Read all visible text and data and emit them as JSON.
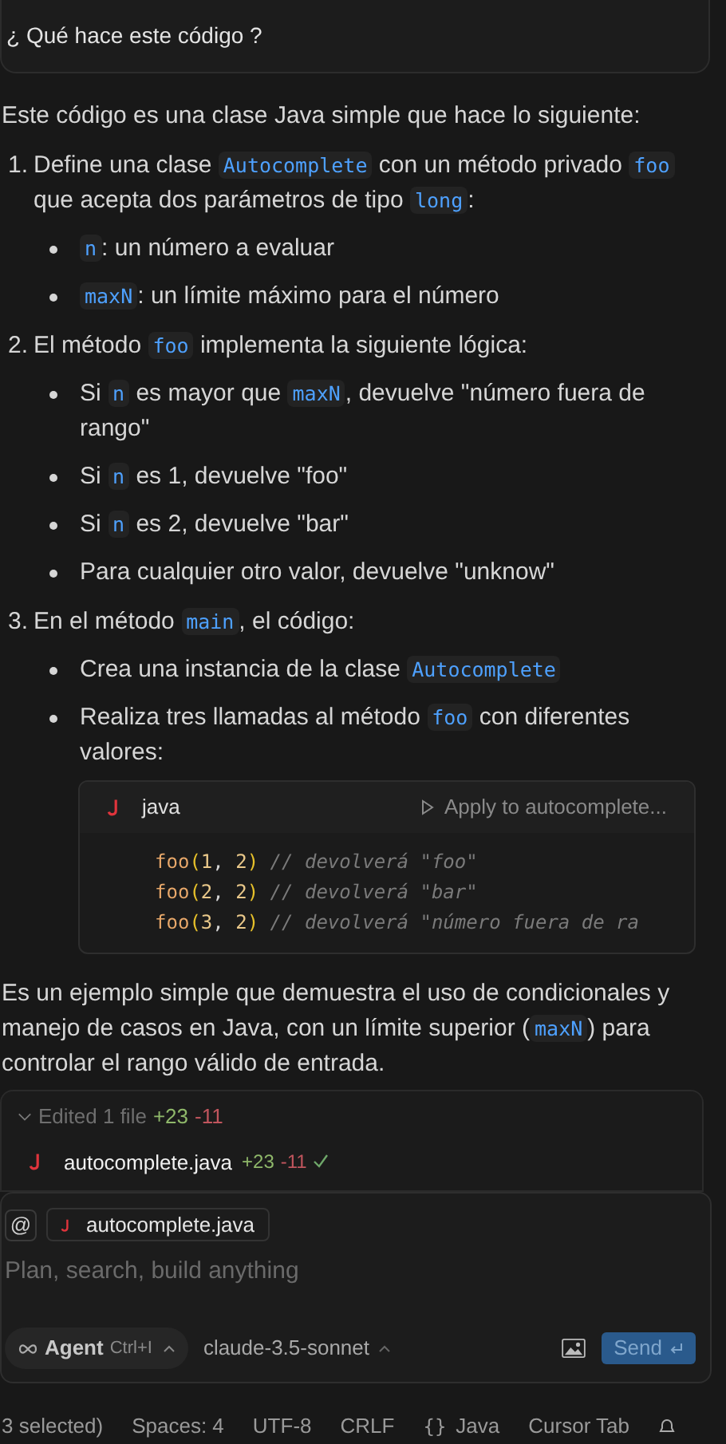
{
  "user_message": {
    "text": "¿ Qué hace este código ?"
  },
  "answer": {
    "intro": "Este código es una clase Java simple que hace lo siguiente:",
    "steps": [
      {
        "number": "1.",
        "parts": [
          {
            "kind": "text",
            "text": "Define una clase "
          },
          {
            "kind": "code",
            "text": "Autocomplete"
          },
          {
            "kind": "text",
            "text": " con un método privado "
          },
          {
            "kind": "code",
            "text": "foo"
          },
          {
            "kind": "text",
            "text": " que acepta dos parámetros de tipo "
          },
          {
            "kind": "code",
            "text": "long"
          },
          {
            "kind": "text",
            "text": ":"
          }
        ],
        "bullets": [
          {
            "parts": [
              {
                "kind": "code",
                "text": "n"
              },
              {
                "kind": "text",
                "text": ": un número a evaluar"
              }
            ]
          },
          {
            "parts": [
              {
                "kind": "code",
                "text": "maxN"
              },
              {
                "kind": "text",
                "text": ": un límite máximo para el número"
              }
            ]
          }
        ]
      },
      {
        "number": "2.",
        "parts": [
          {
            "kind": "text",
            "text": "El método "
          },
          {
            "kind": "code",
            "text": "foo"
          },
          {
            "kind": "text",
            "text": " implementa la siguiente lógica:"
          }
        ],
        "bullets": [
          {
            "parts": [
              {
                "kind": "text",
                "text": "Si "
              },
              {
                "kind": "code",
                "text": "n"
              },
              {
                "kind": "text",
                "text": " es mayor que "
              },
              {
                "kind": "code",
                "text": "maxN"
              },
              {
                "kind": "text",
                "text": ", devuelve \"número fuera de rango\""
              }
            ]
          },
          {
            "parts": [
              {
                "kind": "text",
                "text": "Si "
              },
              {
                "kind": "code",
                "text": "n"
              },
              {
                "kind": "text",
                "text": " es 1, devuelve \"foo\""
              }
            ]
          },
          {
            "parts": [
              {
                "kind": "text",
                "text": "Si "
              },
              {
                "kind": "code",
                "text": "n"
              },
              {
                "kind": "text",
                "text": " es 2, devuelve \"bar\""
              }
            ]
          },
          {
            "parts": [
              {
                "kind": "text",
                "text": "Para cualquier otro valor, devuelve \"unknow\""
              }
            ]
          }
        ]
      },
      {
        "number": "3.",
        "parts": [
          {
            "kind": "text",
            "text": "En el método "
          },
          {
            "kind": "code",
            "text": "main"
          },
          {
            "kind": "text",
            "text": ", el código:"
          }
        ],
        "bullets": [
          {
            "parts": [
              {
                "kind": "text",
                "text": "Crea una instancia de la clase "
              },
              {
                "kind": "code",
                "text": "Autocomplete"
              }
            ]
          },
          {
            "parts": [
              {
                "kind": "text",
                "text": "Realiza tres llamadas al método "
              },
              {
                "kind": "code",
                "text": "foo"
              },
              {
                "kind": "text",
                "text": " con diferentes valores:"
              }
            ],
            "code_block": {
              "language": "java",
              "apply_label": "Apply to autocomplete...",
              "lines": [
                [
                  {
                    "kind": "fn",
                    "text": "foo"
                  },
                  {
                    "kind": "paren",
                    "text": "("
                  },
                  {
                    "kind": "num",
                    "text": "1"
                  },
                  {
                    "kind": "punct",
                    "text": ", "
                  },
                  {
                    "kind": "num",
                    "text": "2"
                  },
                  {
                    "kind": "paren",
                    "text": ")"
                  },
                  {
                    "kind": "comment",
                    "text": " // devolverá \"foo\""
                  }
                ],
                [
                  {
                    "kind": "fn",
                    "text": "foo"
                  },
                  {
                    "kind": "paren",
                    "text": "("
                  },
                  {
                    "kind": "num",
                    "text": "2"
                  },
                  {
                    "kind": "punct",
                    "text": ", "
                  },
                  {
                    "kind": "num",
                    "text": "2"
                  },
                  {
                    "kind": "paren",
                    "text": ")"
                  },
                  {
                    "kind": "comment",
                    "text": " // devolverá \"bar\""
                  }
                ],
                [
                  {
                    "kind": "fn",
                    "text": "foo"
                  },
                  {
                    "kind": "paren",
                    "text": "("
                  },
                  {
                    "kind": "num",
                    "text": "3"
                  },
                  {
                    "kind": "punct",
                    "text": ", "
                  },
                  {
                    "kind": "num",
                    "text": "2"
                  },
                  {
                    "kind": "paren",
                    "text": ")"
                  },
                  {
                    "kind": "comment",
                    "text": " // devolverá \"número fuera de ra"
                  }
                ]
              ]
            }
          }
        ]
      }
    ],
    "outro": [
      {
        "kind": "text",
        "text": "Es un ejemplo simple que demuestra el uso de condicionales y manejo de casos en Java, con un límite superior ("
      },
      {
        "kind": "code",
        "text": "maxN"
      },
      {
        "kind": "text",
        "text": ") para controlar el rango válido de entrada."
      }
    ]
  },
  "edits": {
    "expanded": true,
    "summary": "Edited 1 file",
    "added": "+23",
    "removed": "-11",
    "files": [
      {
        "name": "autocomplete.java",
        "added": "+23",
        "removed": "-11",
        "applied": true
      }
    ]
  },
  "composer": {
    "mention": "@",
    "context_file": "autocomplete.java",
    "placeholder": "Plan, search, build anything",
    "mode": "Agent",
    "mode_shortcut": "Ctrl+I",
    "model": "claude-3.5-sonnet",
    "send": "Send"
  },
  "status_bar": [
    {
      "text": "3 selected)"
    },
    {
      "text": "Spaces: 4"
    },
    {
      "text": "UTF-8"
    },
    {
      "text": "CRLF"
    },
    {
      "glyph": "{}",
      "text": "Java"
    },
    {
      "text": "Cursor Tab"
    }
  ]
}
